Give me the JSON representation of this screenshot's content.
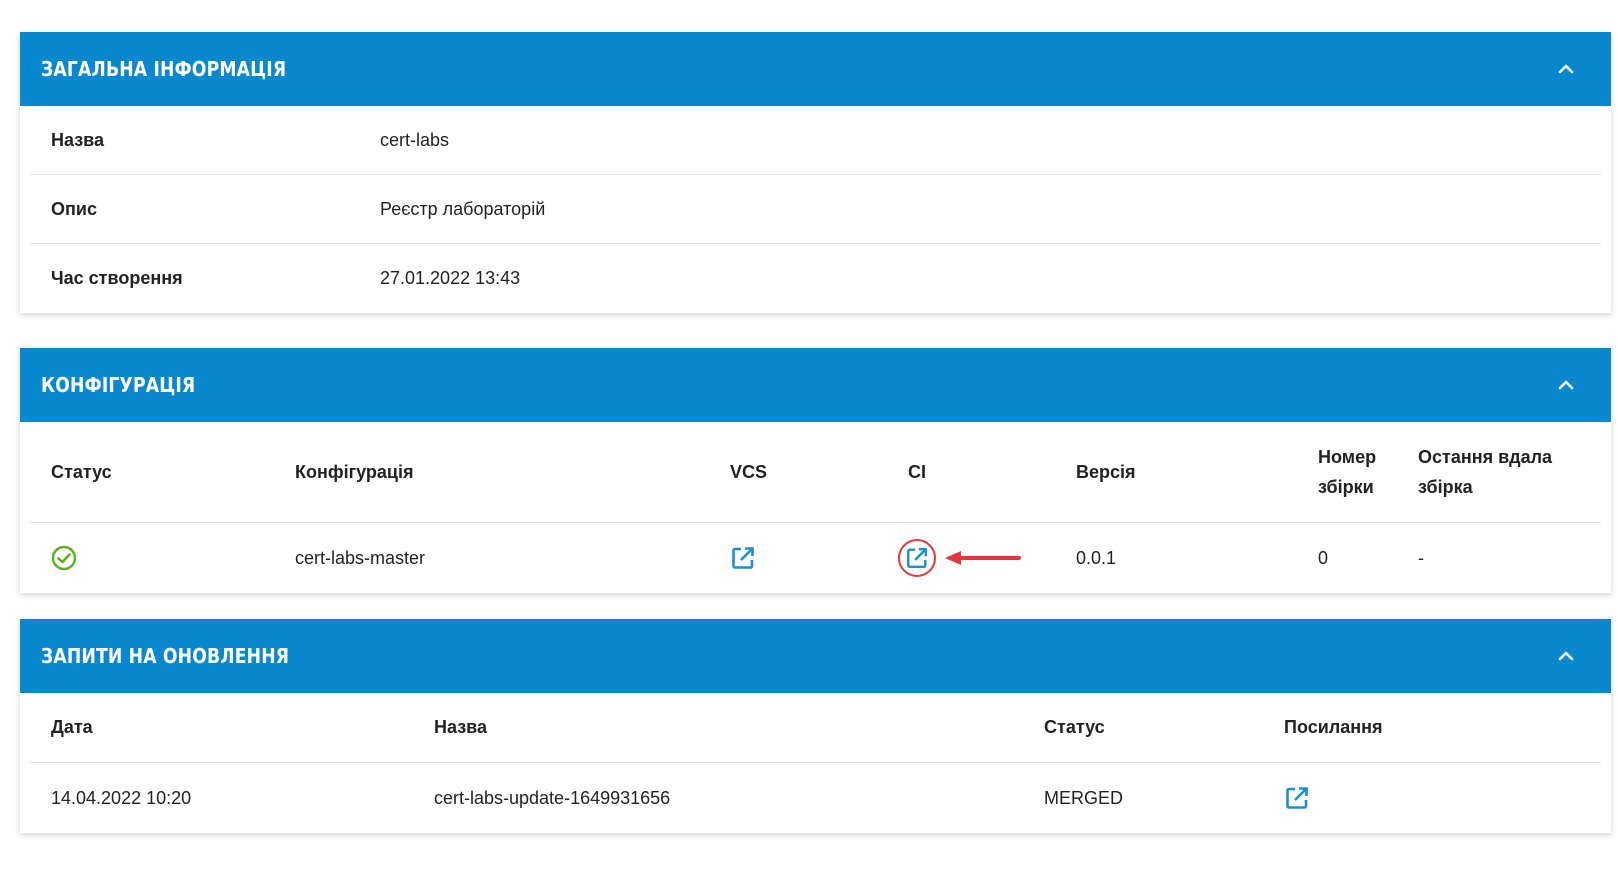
{
  "general": {
    "title": "ЗАГАЛЬНА ІНФОРМАЦІЯ",
    "rows": [
      {
        "label": "Назва",
        "value": "cert-labs"
      },
      {
        "label": "Опис",
        "value": "Реєстр лабораторій"
      },
      {
        "label": "Час створення",
        "value": "27.01.2022 13:43"
      }
    ]
  },
  "config": {
    "title": "КОНФІГУРАЦІЯ",
    "headers": {
      "status": "Статус",
      "configuration": "Конфігурація",
      "vcs": "VCS",
      "ci": "CI",
      "version": "Версія",
      "build_number_1": "Номер",
      "build_number_2": "збірки",
      "last_build_1": "Остання вдала",
      "last_build_2": "збірка"
    },
    "row": {
      "status_icon": "check-circle-icon",
      "configuration": "cert-labs-master",
      "vcs_icon": "external-link-icon",
      "ci_icon": "external-link-icon",
      "version": "0.0.1",
      "build_number": "0",
      "last_build": "-"
    }
  },
  "updates": {
    "title": "ЗАПИТИ НА ОНОВЛЕННЯ",
    "headers": {
      "date": "Дата",
      "name": "Назва",
      "status": "Статус",
      "link": "Посилання"
    },
    "row": {
      "date": "14.04.2022 10:20",
      "name": "cert-labs-update-1649931656",
      "status": "MERGED",
      "link_icon": "external-link-icon"
    }
  },
  "colors": {
    "header_bg": "#0a88cf",
    "link_icon": "#1a8fd6",
    "success": "#5cb01c",
    "annotation": "#e0383e"
  }
}
